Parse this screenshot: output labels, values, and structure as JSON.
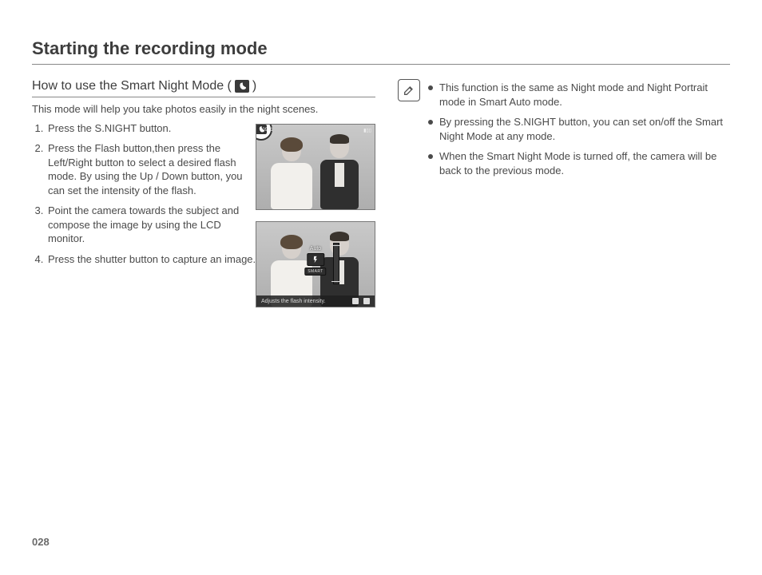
{
  "page": {
    "title": "Starting the recording mode",
    "number": "028"
  },
  "section": {
    "heading_prefix": "How to use the Smart Night Mode (",
    "heading_suffix": ")",
    "mode_icon": "night-mode-icon",
    "intro": "This mode will help you take photos easily in the night scenes.",
    "steps": [
      "Press the S.NIGHT button.",
      "Press the Flash button,then press the Left/Right button to select a desired flash mode. By using the Up / Down button, you can set the intensity of the flash.",
      "Point the camera towards the subject and compose the image by using the LCD monitor.",
      "Press the shutter button to capture an image."
    ]
  },
  "screenshots": {
    "shot1": {
      "top_left": "00931",
      "corner_icon": "night-mode-icon"
    },
    "shot2": {
      "auto_label": "Auto",
      "chip": "SMART",
      "status_text": "Adjusts the flash intensity."
    }
  },
  "sidebar": {
    "icon": "note-pencil-icon",
    "notes": [
      "This function is the same as Night mode and Night Portrait mode in Smart Auto mode.",
      "By pressing the S.NIGHT button, you can set on/off the Smart Night Mode at any mode.",
      "When the Smart Night Mode is turned off, the camera will be back to the previous mode."
    ]
  }
}
